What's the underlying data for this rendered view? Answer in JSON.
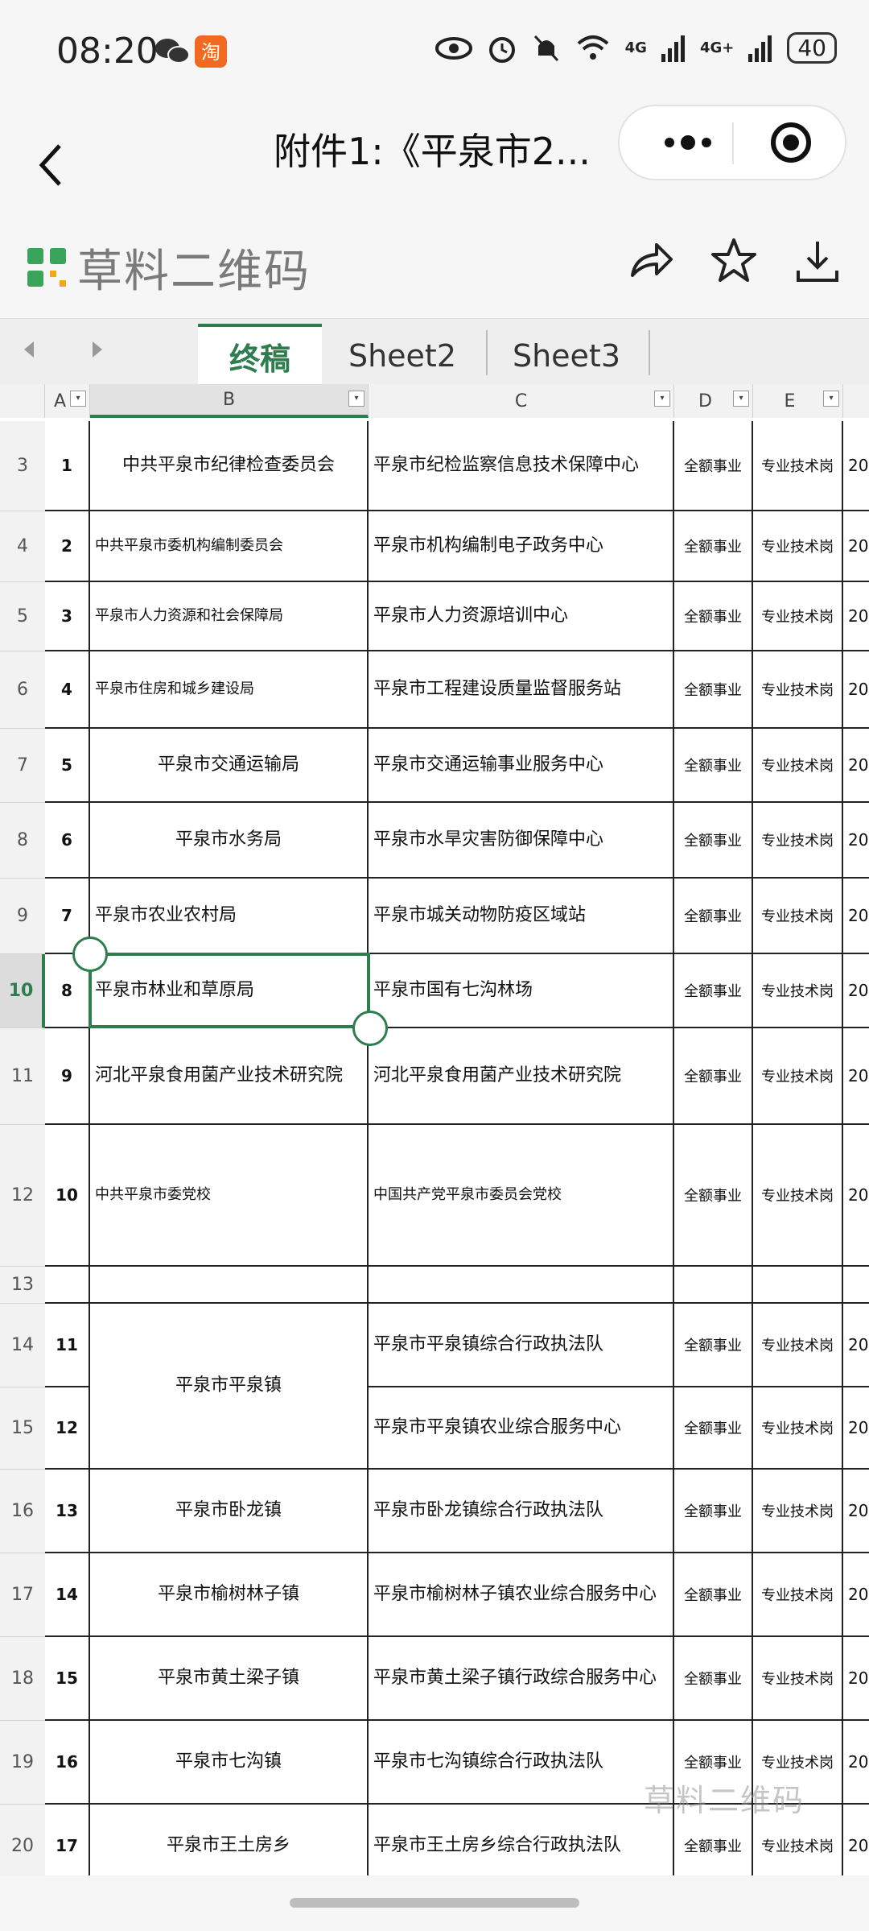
{
  "status": {
    "time": "08:20",
    "battery": "40",
    "signal1": "4G",
    "signal2": "4G+"
  },
  "titlebar": {
    "title": "附件1:《平泉市2..."
  },
  "app": {
    "brand": "草料二维码",
    "watermark": "草料二维码"
  },
  "tabs": [
    {
      "label": "终稿",
      "active": true
    },
    {
      "label": "Sheet2",
      "active": false
    },
    {
      "label": "Sheet3",
      "active": false
    }
  ],
  "columns": [
    "A",
    "B",
    "C",
    "D",
    "E"
  ],
  "rows": [
    {
      "rn": "3",
      "a": "1",
      "b": "中共平泉市纪律检查委员会",
      "c": "平泉市纪检监察信息技术保障中心",
      "d": "全额事业",
      "e": "专业技术岗",
      "f": "20"
    },
    {
      "rn": "4",
      "a": "2",
      "b": "中共平泉市委机构编制委员会",
      "c": "平泉市机构编制电子政务中心",
      "d": "全额事业",
      "e": "专业技术岗",
      "f": "20"
    },
    {
      "rn": "5",
      "a": "3",
      "b": "平泉市人力资源和社会保障局",
      "c": "平泉市人力资源培训中心",
      "d": "全额事业",
      "e": "专业技术岗",
      "f": "20"
    },
    {
      "rn": "6",
      "a": "4",
      "b": "平泉市住房和城乡建设局",
      "c": "平泉市工程建设质量监督服务站",
      "d": "全额事业",
      "e": "专业技术岗",
      "f": "20"
    },
    {
      "rn": "7",
      "a": "5",
      "b": "平泉市交通运输局",
      "c": "平泉市交通运输事业服务中心",
      "d": "全额事业",
      "e": "专业技术岗",
      "f": "20"
    },
    {
      "rn": "8",
      "a": "6",
      "b": "平泉市水务局",
      "c": "平泉市水旱灾害防御保障中心",
      "d": "全额事业",
      "e": "专业技术岗",
      "f": "20"
    },
    {
      "rn": "9",
      "a": "7",
      "b": "平泉市农业农村局",
      "c": "平泉市城关动物防疫区域站",
      "d": "全额事业",
      "e": "专业技术岗",
      "f": "20"
    },
    {
      "rn": "10",
      "a": "8",
      "b": "平泉市林业和草原局",
      "c": "平泉市国有七沟林场",
      "d": "全额事业",
      "e": "专业技术岗",
      "f": "20"
    },
    {
      "rn": "11",
      "a": "9",
      "b": "河北平泉食用菌产业技术研究院",
      "c": "河北平泉食用菌产业技术研究院",
      "d": "全额事业",
      "e": "专业技术岗",
      "f": "20"
    },
    {
      "rn": "12",
      "a": "10",
      "b": "中共平泉市委党校",
      "c": "中国共产党平泉市委员会党校",
      "d": "全额事业",
      "e": "专业技术岗",
      "f": "20"
    },
    {
      "rn": "13",
      "a": "",
      "b": "",
      "c": "",
      "d": "",
      "e": "",
      "f": ""
    },
    {
      "rn": "14",
      "a": "11",
      "b": "平泉市平泉镇",
      "c": "平泉市平泉镇综合行政执法队",
      "d": "全额事业",
      "e": "专业技术岗",
      "f": "20"
    },
    {
      "rn": "15",
      "a": "12",
      "b": "",
      "c": "平泉市平泉镇农业综合服务中心",
      "d": "全额事业",
      "e": "专业技术岗",
      "f": "20"
    },
    {
      "rn": "16",
      "a": "13",
      "b": "平泉市卧龙镇",
      "c": "平泉市卧龙镇综合行政执法队",
      "d": "全额事业",
      "e": "专业技术岗",
      "f": "20"
    },
    {
      "rn": "17",
      "a": "14",
      "b": "平泉市榆树林子镇",
      "c": "平泉市榆树林子镇农业综合服务中心",
      "d": "全额事业",
      "e": "专业技术岗",
      "f": "20"
    },
    {
      "rn": "18",
      "a": "15",
      "b": "平泉市黄土梁子镇",
      "c": "平泉市黄土梁子镇行政综合服务中心",
      "d": "全额事业",
      "e": "专业技术岗",
      "f": "20"
    },
    {
      "rn": "19",
      "a": "16",
      "b": "平泉市七沟镇",
      "c": "平泉市七沟镇综合行政执法队",
      "d": "全额事业",
      "e": "专业技术岗",
      "f": "20"
    },
    {
      "rn": "20",
      "a": "17",
      "b": "平泉市王土房乡",
      "c": "平泉市王土房乡综合行政执法队",
      "d": "全额事业",
      "e": "专业技术岗",
      "f": "20"
    }
  ],
  "selected_row": "10"
}
